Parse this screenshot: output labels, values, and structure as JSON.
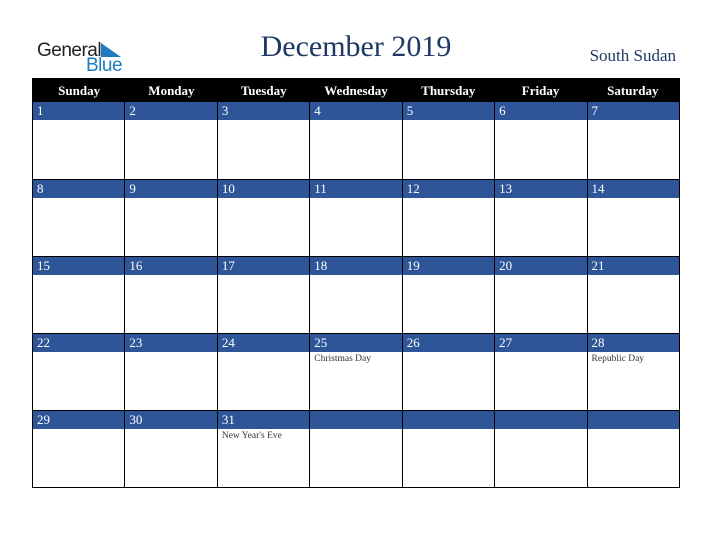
{
  "logo": {
    "line1": "General",
    "line2": "Blue",
    "icon": "triangle-flag-icon",
    "brand_color": "#1f7bc0"
  },
  "title": "December 2019",
  "country": "South Sudan",
  "colors": {
    "header_bg": "#000000",
    "daybar_bg": "#2e5597",
    "title": "#1f3864"
  },
  "weekdays": [
    "Sunday",
    "Monday",
    "Tuesday",
    "Wednesday",
    "Thursday",
    "Friday",
    "Saturday"
  ],
  "weeks": [
    [
      {
        "day": "1",
        "holiday": ""
      },
      {
        "day": "2",
        "holiday": ""
      },
      {
        "day": "3",
        "holiday": ""
      },
      {
        "day": "4",
        "holiday": ""
      },
      {
        "day": "5",
        "holiday": ""
      },
      {
        "day": "6",
        "holiday": ""
      },
      {
        "day": "7",
        "holiday": ""
      }
    ],
    [
      {
        "day": "8",
        "holiday": ""
      },
      {
        "day": "9",
        "holiday": ""
      },
      {
        "day": "10",
        "holiday": ""
      },
      {
        "day": "11",
        "holiday": ""
      },
      {
        "day": "12",
        "holiday": ""
      },
      {
        "day": "13",
        "holiday": ""
      },
      {
        "day": "14",
        "holiday": ""
      }
    ],
    [
      {
        "day": "15",
        "holiday": ""
      },
      {
        "day": "16",
        "holiday": ""
      },
      {
        "day": "17",
        "holiday": ""
      },
      {
        "day": "18",
        "holiday": ""
      },
      {
        "day": "19",
        "holiday": ""
      },
      {
        "day": "20",
        "holiday": ""
      },
      {
        "day": "21",
        "holiday": ""
      }
    ],
    [
      {
        "day": "22",
        "holiday": ""
      },
      {
        "day": "23",
        "holiday": ""
      },
      {
        "day": "24",
        "holiday": ""
      },
      {
        "day": "25",
        "holiday": "Christmas Day"
      },
      {
        "day": "26",
        "holiday": ""
      },
      {
        "day": "27",
        "holiday": ""
      },
      {
        "day": "28",
        "holiday": "Republic Day"
      }
    ],
    [
      {
        "day": "29",
        "holiday": ""
      },
      {
        "day": "30",
        "holiday": ""
      },
      {
        "day": "31",
        "holiday": "New Year's Eve"
      },
      {
        "day": "",
        "holiday": ""
      },
      {
        "day": "",
        "holiday": ""
      },
      {
        "day": "",
        "holiday": ""
      },
      {
        "day": "",
        "holiday": ""
      }
    ]
  ]
}
